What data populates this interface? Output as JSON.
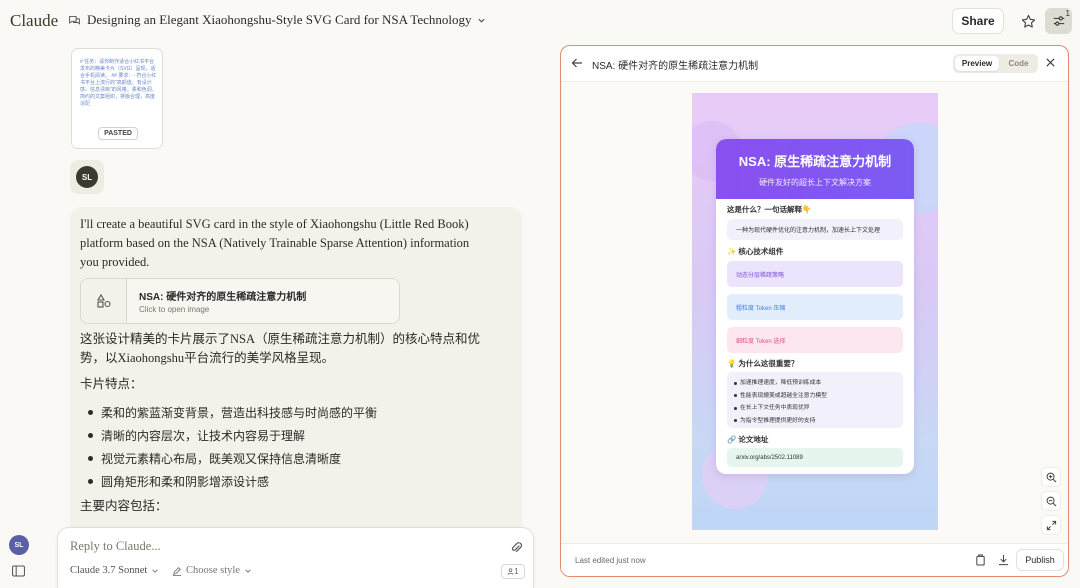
{
  "app": {
    "logo": "Claude"
  },
  "header": {
    "conversation_title": "Designing an Elegant Xiaohongshu-Style SVG Card for NSA Technology",
    "share_label": "Share",
    "settings_badge": "1"
  },
  "chat": {
    "pasted": {
      "preview_text": "# 任务：请你制作适合小红书平台发布的精美卡片（SVG）呈现，适合手机阅读。 ## 要求：- 符合小红书平台上流行的\"高颜值、有设计感、信息清晰\"的风格，柔和色调，简约的文案组织，排版合理，高度适配",
      "tag": "PASTED"
    },
    "user_initials": "SL",
    "assistant": {
      "intro": "I'll create a beautiful SVG card in the style of Xiaohongshu (Little Red Book) platform based on the NSA (Natively Trainable Sparse Attention) information you provided.",
      "artifact_title": "NSA: 硬件对齐的原生稀疏注意力机制",
      "artifact_sub": "Click to open image",
      "summary": "这张设计精美的卡片展示了NSA（原生稀疏注意力机制）的核心特点和优势，以Xiaohongshu平台流行的美学风格呈现。",
      "features_heading": "卡片特点：",
      "features": [
        "柔和的紫蓝渐变背景，营造出科技感与时尚感的平衡",
        "清晰的内容层次，让技术内容易于理解",
        "视觉元素精心布局，既美观又保持信息清晰度",
        "圆角矩形和柔和阴影增添设计感"
      ],
      "content_heading": "主要内容包括："
    }
  },
  "sidebar": {
    "user_initials": "SL"
  },
  "composer": {
    "placeholder": "Reply to Claude...",
    "model": "Claude 3.7 Sonnet",
    "style": "Choose style",
    "count": "1"
  },
  "artifact_panel": {
    "title": "NSA: 硬件对齐的原生稀疏注意力机制",
    "tab_preview": "Preview",
    "tab_code": "Code",
    "footer_status": "Last edited just now",
    "publish_label": "Publish",
    "card": {
      "title": "NSA: 原生稀疏注意力机制",
      "subtitle": "硬件友好的超长上下文解决方案",
      "q1_heading": "这是什么？一句话解释👇",
      "q1_text": "一种为现代硬件优化的注意力机制，加速长上下文处理",
      "components_heading": "✨ 核心技术组件",
      "components": [
        {
          "label": "动态分层稀疏策略",
          "bg": "#ece4fc",
          "fg": "#7a4fd8"
        },
        {
          "label": "粗粒度 Token 压缩",
          "bg": "#e2eefc",
          "fg": "#3f7fd8"
        },
        {
          "label": "细粒度 Token 选择",
          "bg": "#fce6f0",
          "fg": "#e0528c"
        }
      ],
      "why_heading": "💡 为什么这很重要？",
      "why_items": [
        "加速推理速度，降低预训练成本",
        "性能表现媲美或超越全注意力模型",
        "在长上下文任务中表现优异",
        "为指令型推理提供更好的支持"
      ],
      "paper_heading": "🔗 论文地址",
      "paper_link": "arxiv.org/abs/2502.11089"
    }
  },
  "colors": {
    "accent_border": "#e38a6f",
    "card_header": "#8a4ff0"
  }
}
